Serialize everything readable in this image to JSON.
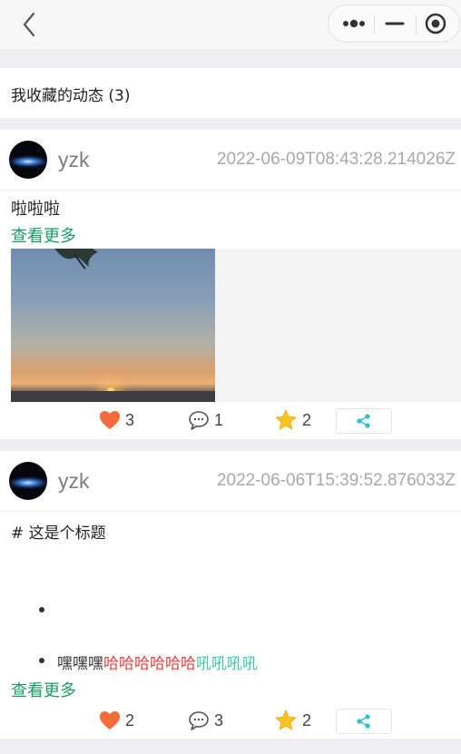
{
  "navbar": {
    "back_icon": "chevron-left-icon",
    "capsule_icons": [
      "more-dots-icon",
      "minimize-icon",
      "record-icon"
    ]
  },
  "section": {
    "title": "我收藏的动态 (3)"
  },
  "posts": [
    {
      "username": "yzk",
      "timestamp": "2022-06-09T08:43:28.214026Z",
      "text": "啦啦啦",
      "more_label": "查看更多",
      "likes": "3",
      "comments": "1",
      "favorites": "2"
    },
    {
      "username": "yzk",
      "timestamp": "2022-06-06T15:39:52.876033Z",
      "title_line": "# 这是个标题",
      "list_item_plain": "嘿嘿嘿",
      "list_item_red": "哈哈哈哈哈哈",
      "list_item_teal": "吼吼吼吼",
      "more_label": "查看更多",
      "likes": "2",
      "comments": "3",
      "favorites": "2"
    }
  ],
  "colors": {
    "accent_green": "#1a9c66",
    "like_orange": "#f26b3a",
    "star_yellow": "#f7c325",
    "share_teal": "#2cc0c9",
    "text_red": "#e83c3c",
    "text_teal": "#41c7a8"
  }
}
